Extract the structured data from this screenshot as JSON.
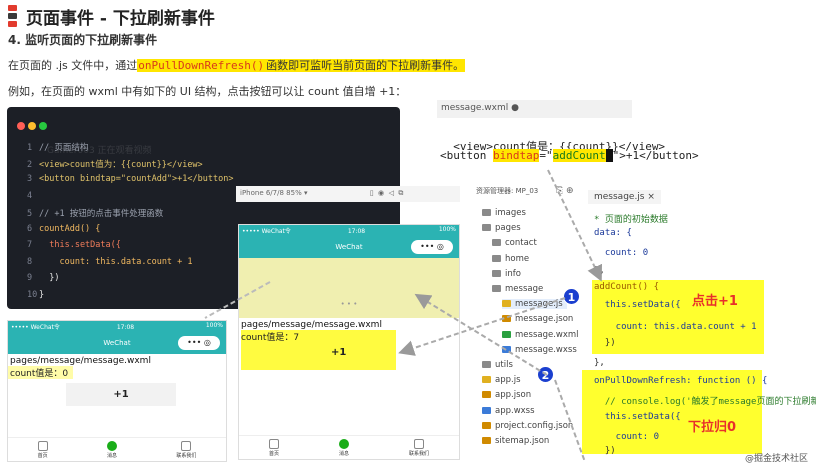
{
  "header": {
    "title": "页面事件 - 下拉刷新事件",
    "subtitle": "4. 监听页面的下拉刷新事件",
    "para1_pre": "在页面的 .js 文件中，通过",
    "para1_highlight": "onPullDownRefresh()",
    "para1_post": "函数即可监听当前页面的下拉刷新事件。",
    "para2": "例如，在页面的 wxml 中有如下的 UI 结构，点击按钮可以让 count 值自增 +1：",
    "mark_colors": [
      "#e23b2e",
      "#3a3a3a",
      "#e23b2e"
    ]
  },
  "code_panel": {
    "lines": [
      {
        "n": "1",
        "text": "// 页面结构",
        "color": "#9aa0ad"
      },
      {
        "n": "2",
        "text": "<view>count值为：{{count}}</view>",
        "color": "#e0c36a"
      },
      {
        "n": "3",
        "text": "<button bindtap=\"countAdd\">+1</button>",
        "color": "#e0c36a"
      },
      {
        "n": "4",
        "text": "",
        "color": "#ccc"
      },
      {
        "n": "5",
        "text": "// +1 按钮的点击事件处理函数",
        "color": "#9aa0ad"
      },
      {
        "n": "6",
        "text": "countAdd() {",
        "color": "#f0b860"
      },
      {
        "n": "7",
        "text": "  this.setData({",
        "color": "#f07c5a"
      },
      {
        "n": "8",
        "text": "    count: this.data.count + 1",
        "color": "#f0b860"
      },
      {
        "n": "9",
        "text": "  })",
        "color": "#e8e8e8"
      },
      {
        "n": "10",
        "text": "}",
        "color": "#e8e8e8"
      }
    ],
    "watermark": "Gamer003 正在观看视频"
  },
  "wxml_editor": {
    "tab_label": "message.wxml ●",
    "line1": "<view>count值是：{{count}}</view>",
    "line2_pre": "<button ",
    "line2_attr": "bindtap",
    "line2_eq": "=\"",
    "line2_val": "addCount",
    "line2_post": "\">+1</button>"
  },
  "phone_small": {
    "status_left": "••••• WeChat令",
    "status_time": "17:08",
    "status_right": "100%",
    "nav_title": "WeChat",
    "path": "pages/message/message.wxml",
    "count_text": "count值是：0",
    "button": "+1",
    "tabs": [
      "首页",
      "消息",
      "联系我们"
    ],
    "theme_color": "#2bb3b3"
  },
  "phone_large": {
    "device": "iPhone 6/7/8 85% ▾",
    "status_left": "••••• WeChat令",
    "status_time": "17:08",
    "status_right": "100%",
    "nav_title": "WeChat",
    "refresh_dots": "• • •",
    "path": "pages/message/message.wxml",
    "count_text": "count值是：7",
    "button": "+1",
    "tabs": [
      "首页",
      "消息",
      "联系我们"
    ],
    "theme_color": "#2bb3b3",
    "refresh_bg": "#f0efb0"
  },
  "explorer": {
    "title": "资源管理器: MP_03",
    "items": [
      {
        "label": "images",
        "indent": 0,
        "kind": "folder"
      },
      {
        "label": "pages",
        "indent": 0,
        "kind": "folder"
      },
      {
        "label": "contact",
        "indent": 1,
        "kind": "folder"
      },
      {
        "label": "home",
        "indent": 1,
        "kind": "folder"
      },
      {
        "label": "info",
        "indent": 1,
        "kind": "folder"
      },
      {
        "label": "message",
        "indent": 1,
        "kind": "folder"
      },
      {
        "label": "message.js",
        "indent": 2,
        "kind": "js"
      },
      {
        "label": "message.json",
        "indent": 2,
        "kind": "json"
      },
      {
        "label": "message.wxml",
        "indent": 2,
        "kind": "wxml"
      },
      {
        "label": "message.wxss",
        "indent": 2,
        "kind": "wxss"
      },
      {
        "label": "utils",
        "indent": 0,
        "kind": "folder"
      },
      {
        "label": "app.js",
        "indent": 0,
        "kind": "js"
      },
      {
        "label": "app.json",
        "indent": 0,
        "kind": "json"
      },
      {
        "label": "app.wxss",
        "indent": 0,
        "kind": "wxss"
      },
      {
        "label": "project.config.json",
        "indent": 0,
        "kind": "json"
      },
      {
        "label": "sitemap.json",
        "indent": 0,
        "kind": "json"
      }
    ]
  },
  "js_editor": {
    "tab_label": "message.js ×",
    "lines": [
      "* 页面的初始数据",
      "data: {",
      "  count: 0",
      "},",
      "addCount() {",
      "  this.setData({",
      "    count: this.data.count + 1",
      "  })",
      "},",
      "onPullDownRefresh: function () {",
      "  // console.log('触发了message页面的下拉刷新')",
      "  this.setData({",
      "    count: 0",
      "  })"
    ],
    "callout1": "点击+1",
    "callout2": "下拉归0",
    "badge1": "1",
    "badge2": "2"
  },
  "footer": {
    "watermark": "@掘金技术社区"
  }
}
